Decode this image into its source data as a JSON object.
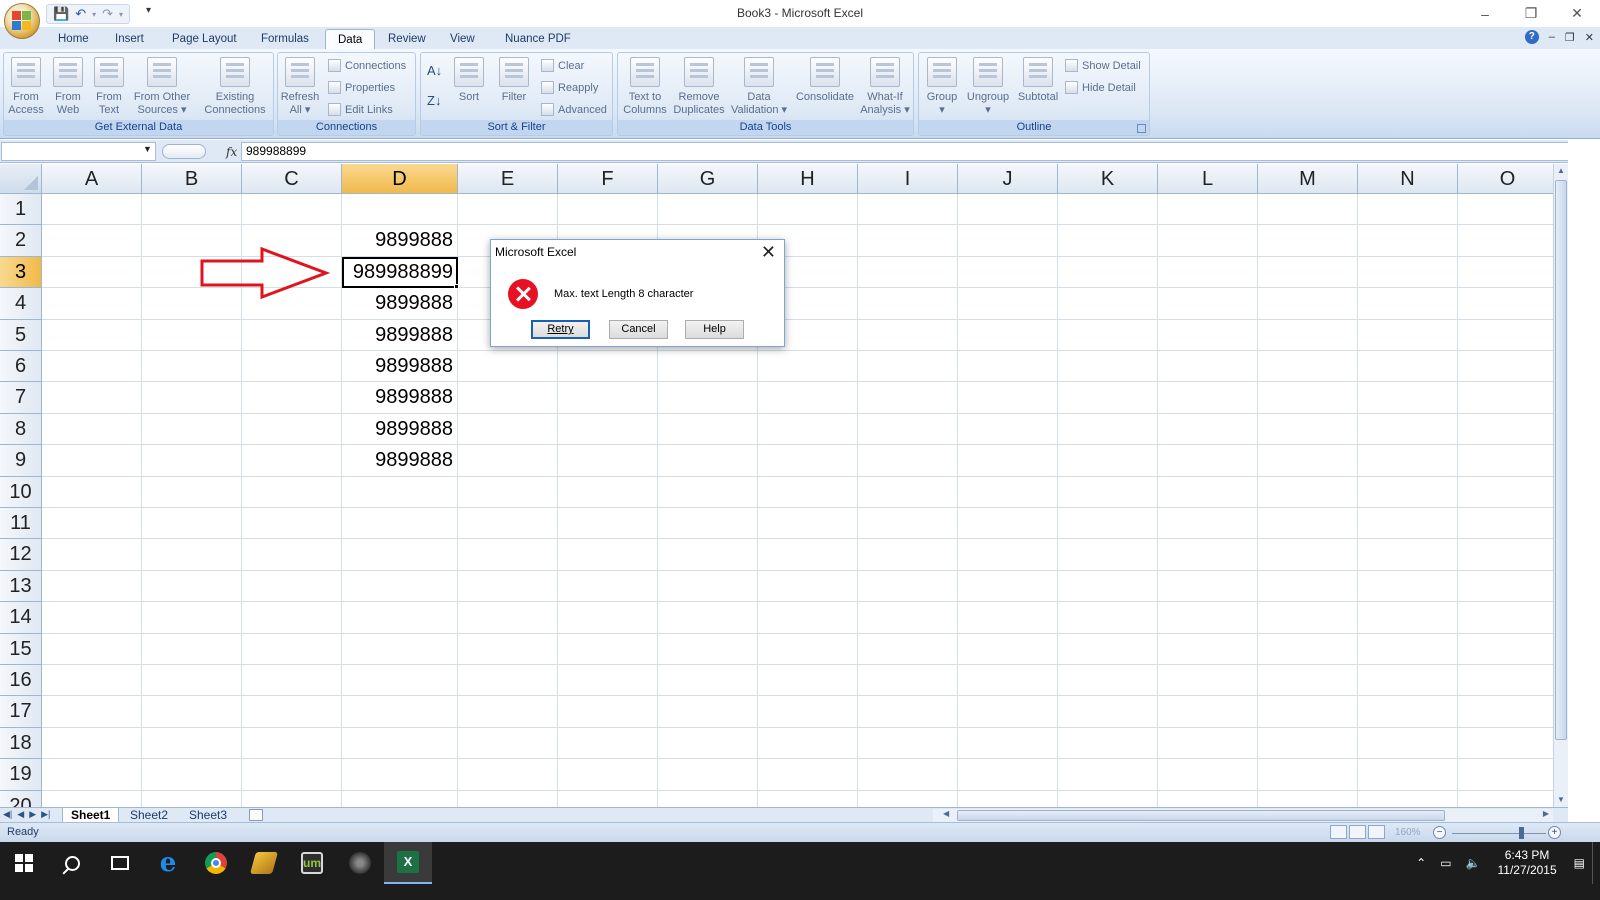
{
  "window": {
    "title": "Book3 - Microsoft Excel",
    "controls": [
      "–",
      "❐",
      "✕"
    ]
  },
  "quick_access": [
    "save-icon",
    "undo-icon",
    "redo-icon",
    "customize-dropdown"
  ],
  "ribbon_tabs": [
    "Home",
    "Insert",
    "Page Layout",
    "Formulas",
    "Data",
    "Review",
    "View",
    "Nuance PDF"
  ],
  "active_tab": "Data",
  "ribbon": {
    "get_external_data": {
      "label": "Get External Data",
      "buttons": [
        {
          "l1": "From",
          "l2": "Access"
        },
        {
          "l1": "From",
          "l2": "Web"
        },
        {
          "l1": "From",
          "l2": "Text"
        },
        {
          "l1": "From Other",
          "l2": "Sources ▾"
        },
        {
          "l1": "Existing",
          "l2": "Connections"
        }
      ]
    },
    "connections": {
      "label": "Connections",
      "refresh": {
        "l1": "Refresh",
        "l2": "All ▾"
      },
      "items": [
        "Connections",
        "Properties",
        "Edit Links"
      ]
    },
    "sort_filter": {
      "label": "Sort & Filter",
      "sort": "Sort",
      "filter": "Filter",
      "items": [
        "Clear",
        "Reapply",
        "Advanced"
      ]
    },
    "data_tools": {
      "label": "Data Tools",
      "buttons": [
        {
          "l1": "Text to",
          "l2": "Columns"
        },
        {
          "l1": "Remove",
          "l2": "Duplicates"
        },
        {
          "l1": "Data",
          "l2": "Validation ▾"
        },
        {
          "l1": "Consolidate",
          "l2": ""
        },
        {
          "l1": "What-If",
          "l2": "Analysis ▾"
        }
      ]
    },
    "outline": {
      "label": "Outline",
      "buttons": [
        {
          "l1": "Group",
          "l2": "▾"
        },
        {
          "l1": "Ungroup",
          "l2": "▾"
        },
        {
          "l1": "Subtotal",
          "l2": ""
        }
      ],
      "items": [
        "Show Detail",
        "Hide Detail"
      ]
    }
  },
  "formula_bar": {
    "name_box": "",
    "fx": "fx",
    "value": "989988899"
  },
  "sheet": {
    "columns": [
      "A",
      "B",
      "C",
      "D",
      "E",
      "F",
      "G",
      "H",
      "I",
      "J",
      "K",
      "L",
      "M",
      "N",
      "O"
    ],
    "rows": [
      "1",
      "2",
      "3",
      "4",
      "5",
      "6",
      "7",
      "8",
      "9",
      "10",
      "11",
      "12",
      "13",
      "14",
      "15",
      "16",
      "17",
      "18",
      "19",
      "20"
    ],
    "selected_column": "D",
    "selected_row": "3",
    "cells_d": [
      {
        "row": "2",
        "value": "9899888"
      },
      {
        "row": "3",
        "value": "989988899"
      },
      {
        "row": "4",
        "value": "9899888"
      },
      {
        "row": "5",
        "value": "9899888"
      },
      {
        "row": "6",
        "value": "9899888"
      },
      {
        "row": "7",
        "value": "9899888"
      },
      {
        "row": "8",
        "value": "9899888"
      },
      {
        "row": "9",
        "value": "9899888"
      }
    ]
  },
  "sheet_tabs": [
    "Sheet1",
    "Sheet2",
    "Sheet3"
  ],
  "active_sheet": "Sheet1",
  "status": {
    "text": "Ready",
    "zoom": "160%"
  },
  "dialog": {
    "title": "Microsoft Excel",
    "message": "Max. text Length 8 character",
    "buttons": [
      "Retry",
      "Cancel",
      "Help"
    ]
  },
  "taskbar": {
    "apps": [
      "start-icon",
      "search-icon",
      "task-view-icon",
      "edge-icon",
      "chrome-icon",
      "winrar-icon",
      "um-icon",
      "app-icon",
      "excel-icon"
    ],
    "time": "6:43 PM",
    "date": "11/27/2015"
  },
  "colors": {
    "accent": "#f1b94a",
    "ribbon": "#dce7f5",
    "error": "#e81123",
    "arrow": "#e0141e"
  }
}
